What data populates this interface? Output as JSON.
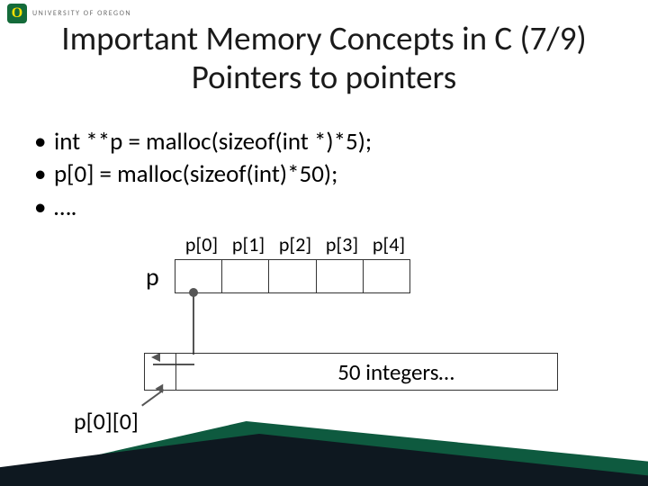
{
  "logo": {
    "text": "UNIVERSITY OF OREGON"
  },
  "title": {
    "line1": "Important Memory Concepts in C (7/9)",
    "line2": "Pointers to pointers"
  },
  "bullets": {
    "b1": "int **p = malloc(sizeof(int *)*5);",
    "b2": "p[0] = malloc(sizeof(int)*50);",
    "b3": "…."
  },
  "diagram": {
    "p_label": "p",
    "cells": {
      "c0": "p[0]",
      "c1": "p[1]",
      "c2": "p[2]",
      "c3": "p[3]",
      "c4": "p[4]"
    },
    "row50_label": "50 integers…",
    "p00_label": "p[0][0]"
  }
}
